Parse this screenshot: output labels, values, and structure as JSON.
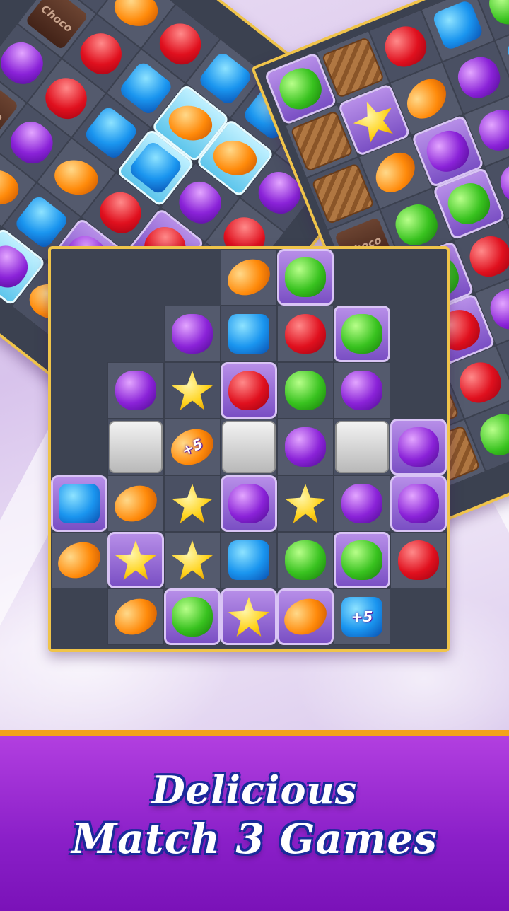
{
  "banner": {
    "line1": "Delicious",
    "line2": "Match 3 Games"
  },
  "colors": {
    "banner": "#8a1fc8",
    "banner_border": "#f4a21a",
    "board_border": "#f0c44a",
    "title_outline": "#1a2a9a"
  },
  "labels": {
    "choco": "Choco",
    "plus_five": "+5"
  },
  "boards": {
    "left": [
      [
        "purple",
        "orange",
        "red",
        "blue",
        "blue",
        "red"
      ],
      [
        "choco",
        "red",
        "blue",
        "ice-orange",
        "ice-orange",
        "purple"
      ],
      [
        "purple",
        "red",
        "blue",
        "ice-blue",
        "purple",
        "red"
      ],
      [
        "choco",
        "purple",
        "orange",
        "red",
        "frame-red",
        "blue"
      ],
      [
        "blue",
        "orange",
        "blue",
        "frame-purple",
        "ice-orange",
        "red"
      ],
      [
        "red",
        "frame-purple",
        "ice-purple",
        "orange",
        "blue",
        "purple"
      ]
    ],
    "right": [
      [
        "frame-green",
        "wood",
        "red",
        "blue",
        "green"
      ],
      [
        "wood",
        "frame-yellow",
        "orange",
        "purple",
        "blue"
      ],
      [
        "wood",
        "orange",
        "frame-purple",
        "purple",
        "green"
      ],
      [
        "choco",
        "green",
        "frame-green",
        "purple",
        "red"
      ],
      [
        "choco",
        "frame-green",
        "red",
        "blue",
        "orange"
      ],
      [
        "choco",
        "frame-red",
        "purple",
        "green",
        "blue"
      ],
      [
        "wood",
        "red",
        "orange",
        "purple",
        "yellow"
      ],
      [
        "wood",
        "green",
        "red",
        "blue",
        "orange"
      ]
    ],
    "center": [
      [
        "empty",
        "empty",
        "empty",
        "orange",
        "frame-green",
        "empty",
        "empty"
      ],
      [
        "empty",
        "empty",
        "purple",
        "blue",
        "red",
        "frame-green",
        "empty"
      ],
      [
        "empty",
        "purple",
        "yellow",
        "frame-red",
        "green",
        "purple",
        "empty"
      ],
      [
        "empty",
        "stone",
        "plus-orange",
        "stone",
        "purple",
        "stone",
        "frame-purple"
      ],
      [
        "frame-blue",
        "orange",
        "yellow",
        "frame-purple",
        "yellow",
        "purple",
        "frame-purple"
      ],
      [
        "orange",
        "frame-yellow",
        "yellow",
        "blue",
        "green",
        "frame-green",
        "red"
      ],
      [
        "empty",
        "orange",
        "frame-green",
        "frame-yellow",
        "frame-orange",
        "plus-blue",
        "empty"
      ]
    ]
  }
}
